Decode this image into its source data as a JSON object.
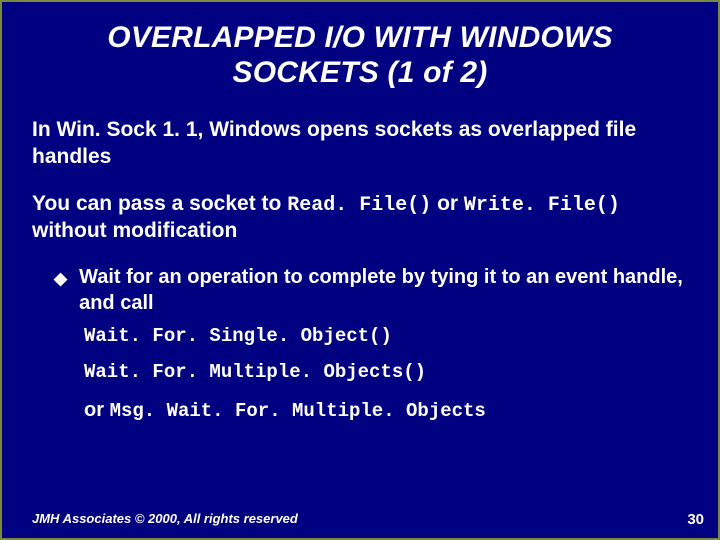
{
  "title_line1": "OVERLAPPED I/O WITH WINDOWS",
  "title_line2": "SOCKETS (1 of 2)",
  "para1": "In Win. Sock 1. 1, Windows opens sockets as overlapped file handles",
  "para2_pre": "You can pass a socket to ",
  "para2_code1": "Read. File()",
  "para2_mid": " or ",
  "para2_code2": "Write. File()",
  "para2_post": " without modification",
  "bullet1": "Wait for an operation to complete by tying it to an event handle, and call",
  "sub1": "Wait. For. Single. Object()",
  "sub2": "Wait. For. Multiple. Objects()",
  "sub3_or": "or ",
  "sub3_code": "Msg. Wait. For. Multiple. Objects",
  "footer": "JMH Associates © 2000, All rights reserved",
  "page": "30"
}
